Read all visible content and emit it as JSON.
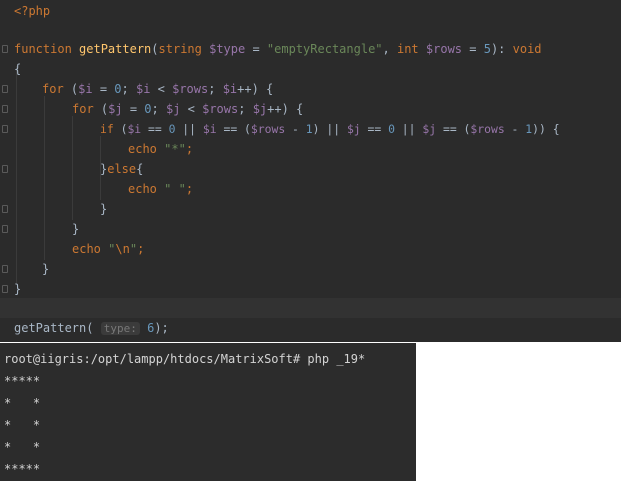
{
  "editor": {
    "l1": "<?php",
    "l2_kw": "function",
    "l2_fn": "getPattern",
    "l2_a": "(",
    "l2_t1": "string",
    "l2_v1": "$type",
    "l2_eq": " = ",
    "l2_s1": "\"emptyRectangle\"",
    "l2_c": ", ",
    "l2_t2": "int",
    "l2_v2": "$rows",
    "l2_eq2": " = ",
    "l2_n": "5",
    "l2_b": "): ",
    "l2_ret": "void",
    "l3": "{",
    "l4_kw": "for",
    "l4_a": " (",
    "l4_v": "$i",
    "l4_b": " = ",
    "l4_n": "0",
    "l4_c": "; ",
    "l4_v2": "$i",
    "l4_d": " < ",
    "l4_v3": "$rows",
    "l4_e": "; ",
    "l4_v4": "$i",
    "l4_f": "++) {",
    "l5_kw": "for",
    "l5_a": " (",
    "l5_v": "$j",
    "l5_b": " = ",
    "l5_n": "0",
    "l5_c": "; ",
    "l5_v2": "$j",
    "l5_d": " < ",
    "l5_v3": "$rows",
    "l5_e": "; ",
    "l5_v4": "$j",
    "l5_f": "++) {",
    "l6_kw": "if",
    "l6_a": " (",
    "l6_v1": "$i",
    "l6_b": " == ",
    "l6_n1": "0",
    "l6_c": " || ",
    "l6_v2": "$i",
    "l6_d": " == (",
    "l6_v3": "$rows",
    "l6_e": " - ",
    "l6_n2": "1",
    "l6_f": ") || ",
    "l6_v4": "$j",
    "l6_g": " == ",
    "l6_n3": "0",
    "l6_h": " || ",
    "l6_v5": "$j",
    "l6_i": " == (",
    "l6_v6": "$rows",
    "l6_j": " - ",
    "l6_n4": "1",
    "l6_k": ")) {",
    "l7_kw": "echo",
    "l7_s": "\"*\"",
    "l7_e": ";",
    "l8_a": "}",
    "l8_kw": "else",
    "l8_b": "{",
    "l9_kw": "echo",
    "l9_s": "\" \"",
    "l9_e": ";",
    "l10": "}",
    "l11": "}",
    "l12_kw": "echo",
    "l12_s1": "\"",
    "l12_esc": "\\n",
    "l12_s2": "\"",
    "l12_e": ";",
    "l13": "}",
    "l14": "}",
    "l15_fn": "getPattern(",
    "l15_hint": "type:",
    "l15_n": "6",
    "l15_e": ");"
  },
  "terminal": {
    "prompt": "root@iigris:/opt/lampp/htdocs/MatrixSoft# php _19*",
    "out1": "*****",
    "out2": "*   *",
    "out3": "*   *",
    "out4": "*   *",
    "out5": "*****"
  }
}
